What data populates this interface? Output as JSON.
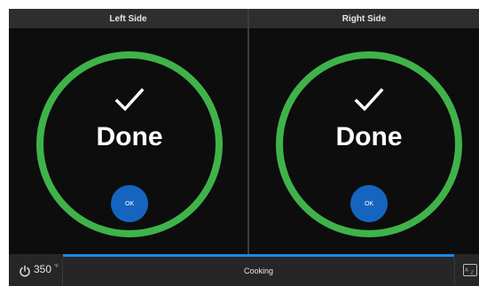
{
  "left_panel": {
    "header": "Left Side",
    "status": "Done",
    "button": "OK"
  },
  "right_panel": {
    "header": "Right Side",
    "status": "Done",
    "button": "OK"
  },
  "footer": {
    "temperature": "350",
    "temperature_unit": "°F",
    "status": "Cooking"
  },
  "icons": {
    "power": "power-icon",
    "language": "language-icon",
    "check": "checkmark-icon"
  },
  "colors": {
    "ring": "#3fb34a",
    "button": "#1565c0",
    "progress": "#1e88e5",
    "background": "#0d0d0d"
  }
}
